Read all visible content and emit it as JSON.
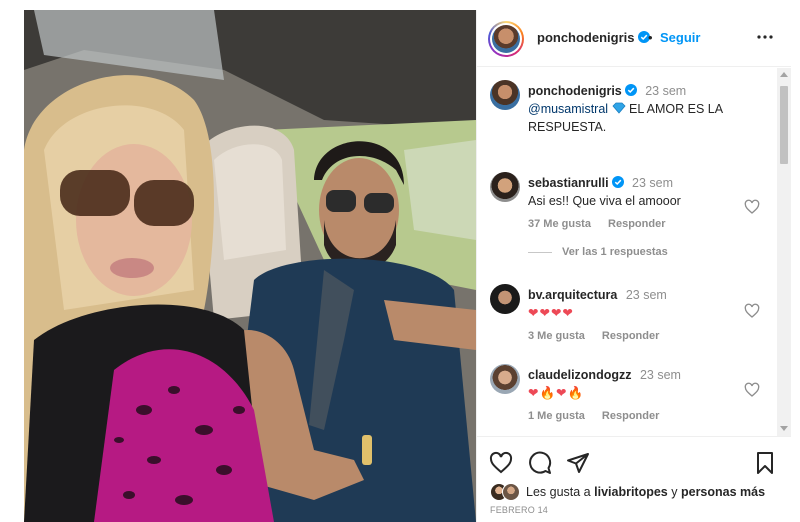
{
  "header": {
    "username": "ponchodenigris",
    "separator": "•",
    "follow_label": "Seguir"
  },
  "caption": {
    "username": "ponchodenigris",
    "time": "23 sem",
    "mention": "@musamistral",
    "text": "EL AMOR ES LA RESPUESTA."
  },
  "comments": [
    {
      "username": "sebastianrulli",
      "time": "23 sem",
      "text": "Asi es!! Que viva el amooor",
      "likes": "37 Me gusta",
      "reply": "Responder"
    },
    {
      "username": "bv.arquitectura",
      "time": "23 sem",
      "text": "❤❤❤❤",
      "likes": "3 Me gusta",
      "reply": "Responder"
    },
    {
      "username": "claudelizondogzz",
      "time": "23 sem",
      "text": "❤🔥❤🔥",
      "likes": "1 Me gusta",
      "reply": "Responder"
    }
  ],
  "view_replies": "Ver las 1 respuestas",
  "likes_line": {
    "prefix": "Les gusta a",
    "user": "liviabritopes",
    "suffix": "y",
    "others": "personas más"
  },
  "post_date": "FEBRERO 14",
  "icons": {
    "verified": "verified-badge-icon",
    "heart": "heart-icon",
    "comment": "comment-icon",
    "share": "paper-plane-icon",
    "save": "bookmark-icon",
    "more": "more-options-icon"
  },
  "colors": {
    "accent": "#0095f6",
    "text": "#262626",
    "muted": "#8e8e8e",
    "heart_emoji": "#ed4956",
    "fire_emoji": "#f77a1c"
  }
}
